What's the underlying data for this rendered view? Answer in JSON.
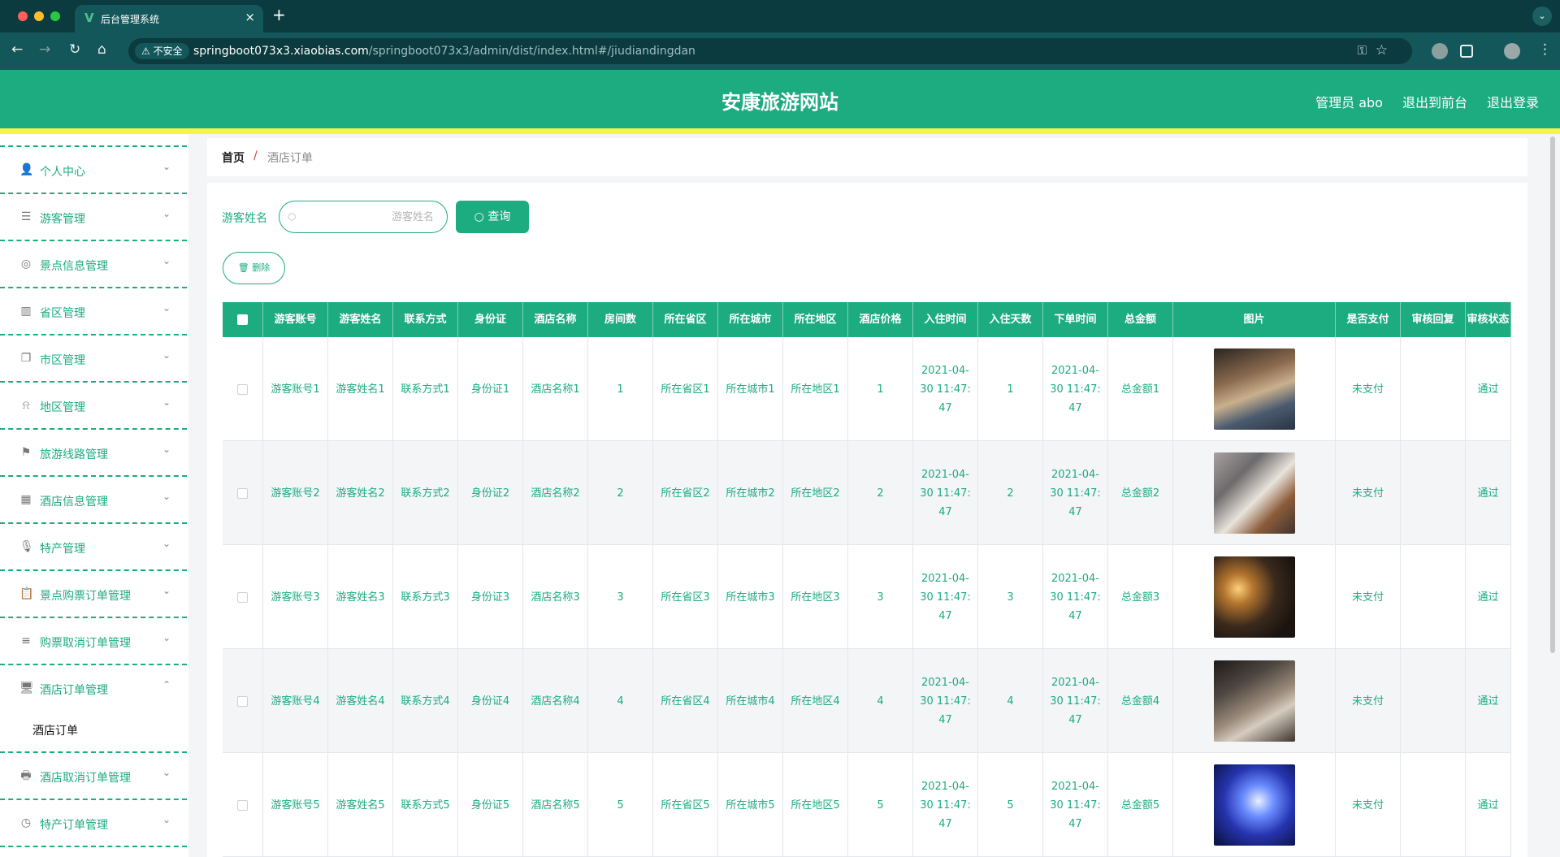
{
  "browser": {
    "tab_title": "后台管理系统",
    "tab_logo": "V",
    "insecure_label": "不安全",
    "url_host": "springboot073x3.xiaobias.com",
    "url_path": "/springboot073x3/admin/dist/index.html#/jiudiandingdan"
  },
  "header": {
    "title": "安康旅游网站",
    "user_label": "管理员 abo",
    "to_front_label": "退出到前台",
    "logout_label": "退出登录",
    "brand_color": "#1dab80"
  },
  "sidebar": {
    "items": [
      {
        "label": "个人中心",
        "icon": "user-icon"
      },
      {
        "label": "游客管理",
        "icon": "list-icon"
      },
      {
        "label": "景点信息管理",
        "icon": "compass-icon"
      },
      {
        "label": "省区管理",
        "icon": "chart-icon"
      },
      {
        "label": "市区管理",
        "icon": "copy-icon"
      },
      {
        "label": "地区管理",
        "icon": "bell-off-icon"
      },
      {
        "label": "旅游线路管理",
        "icon": "flag-icon"
      },
      {
        "label": "酒店信息管理",
        "icon": "grid-icon"
      },
      {
        "label": "特产管理",
        "icon": "microphone-icon"
      },
      {
        "label": "景点购票订单管理",
        "icon": "clipboard-icon"
      },
      {
        "label": "购票取消订单管理",
        "icon": "menu-icon"
      },
      {
        "label": "酒店订单管理",
        "icon": "monitor-icon"
      },
      {
        "label": "酒店取消订单管理",
        "icon": "printer-icon"
      },
      {
        "label": "特产订单管理",
        "icon": "clock-icon"
      }
    ],
    "active_sub": "酒店订单"
  },
  "breadcrumb": {
    "home": "首页",
    "separator": "/",
    "current": "酒店订单"
  },
  "search": {
    "label": "游客姓名",
    "placeholder": "游客姓名",
    "value": "",
    "query_button": "查询",
    "delete_button": "删除"
  },
  "table": {
    "columns": [
      "游客账号",
      "游客姓名",
      "联系方式",
      "身份证",
      "酒店名称",
      "房间数",
      "所在省区",
      "所在城市",
      "所在地区",
      "酒店价格",
      "入住时间",
      "入住天数",
      "下单时间",
      "总金额",
      "图片",
      "是否支付",
      "审核回复",
      "审核状态"
    ],
    "rows": [
      {
        "account": "游客账号1",
        "name": "游客姓名1",
        "phone": "联系方式1",
        "idcard": "身份证1",
        "hotel": "酒店名称1",
        "rooms": "1",
        "province": "所在省区1",
        "city": "所在城市1",
        "district": "所在地区1",
        "price": "1",
        "checkin": "2021-04-30 11:47:47",
        "days": "1",
        "ordered": "2021-04-30 11:47:47",
        "total": "总金额1",
        "image": "hotel-room-photo",
        "paid": "未支付",
        "reply": "",
        "status": "通过"
      },
      {
        "account": "游客账号2",
        "name": "游客姓名2",
        "phone": "联系方式2",
        "idcard": "身份证2",
        "hotel": "酒店名称2",
        "rooms": "2",
        "province": "所在省区2",
        "city": "所在城市2",
        "district": "所在地区2",
        "price": "2",
        "checkin": "2021-04-30 11:47:47",
        "days": "2",
        "ordered": "2021-04-30 11:47:47",
        "total": "总金额2",
        "image": "hotel-room-photo",
        "paid": "未支付",
        "reply": "",
        "status": "通过"
      },
      {
        "account": "游客账号3",
        "name": "游客姓名3",
        "phone": "联系方式3",
        "idcard": "身份证3",
        "hotel": "酒店名称3",
        "rooms": "3",
        "province": "所在省区3",
        "city": "所在城市3",
        "district": "所在地区3",
        "price": "3",
        "checkin": "2021-04-30 11:47:47",
        "days": "3",
        "ordered": "2021-04-30 11:47:47",
        "total": "总金额3",
        "image": "hotel-room-photo",
        "paid": "未支付",
        "reply": "",
        "status": "通过"
      },
      {
        "account": "游客账号4",
        "name": "游客姓名4",
        "phone": "联系方式4",
        "idcard": "身份证4",
        "hotel": "酒店名称4",
        "rooms": "4",
        "province": "所在省区4",
        "city": "所在城市4",
        "district": "所在地区4",
        "price": "4",
        "checkin": "2021-04-30 11:47:47",
        "days": "4",
        "ordered": "2021-04-30 11:47:47",
        "total": "总金额4",
        "image": "hotel-room-photo",
        "paid": "未支付",
        "reply": "",
        "status": "通过"
      },
      {
        "account": "游客账号5",
        "name": "游客姓名5",
        "phone": "联系方式5",
        "idcard": "身份证5",
        "hotel": "酒店名称5",
        "rooms": "5",
        "province": "所在省区5",
        "city": "所在城市5",
        "district": "所在地区5",
        "price": "5",
        "checkin": "2021-04-30 11:47:47",
        "days": "5",
        "ordered": "2021-04-30 11:47:47",
        "total": "总金额5",
        "image": "hotel-room-photo",
        "paid": "未支付",
        "reply": "",
        "status": "通过"
      }
    ]
  }
}
